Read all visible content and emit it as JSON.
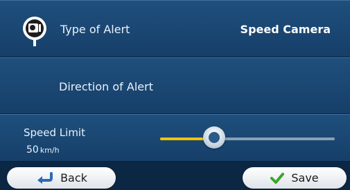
{
  "alert_type": {
    "label": "Type of Alert",
    "value": "Speed Camera",
    "icon": "speed-camera-icon"
  },
  "alert_direction": {
    "label": "Direction of Alert",
    "icon": "direction-icon"
  },
  "speed_limit": {
    "label": "Speed Limit",
    "value": "50",
    "unit": "km/h",
    "slider_fraction": 0.31
  },
  "buttons": {
    "back_label": "Back",
    "save_label": "Save"
  },
  "colors": {
    "panel": "#1f4f7d",
    "accent": "#f2c200",
    "save_check": "#3aa52b",
    "back_arrow": "#2c69b5"
  }
}
